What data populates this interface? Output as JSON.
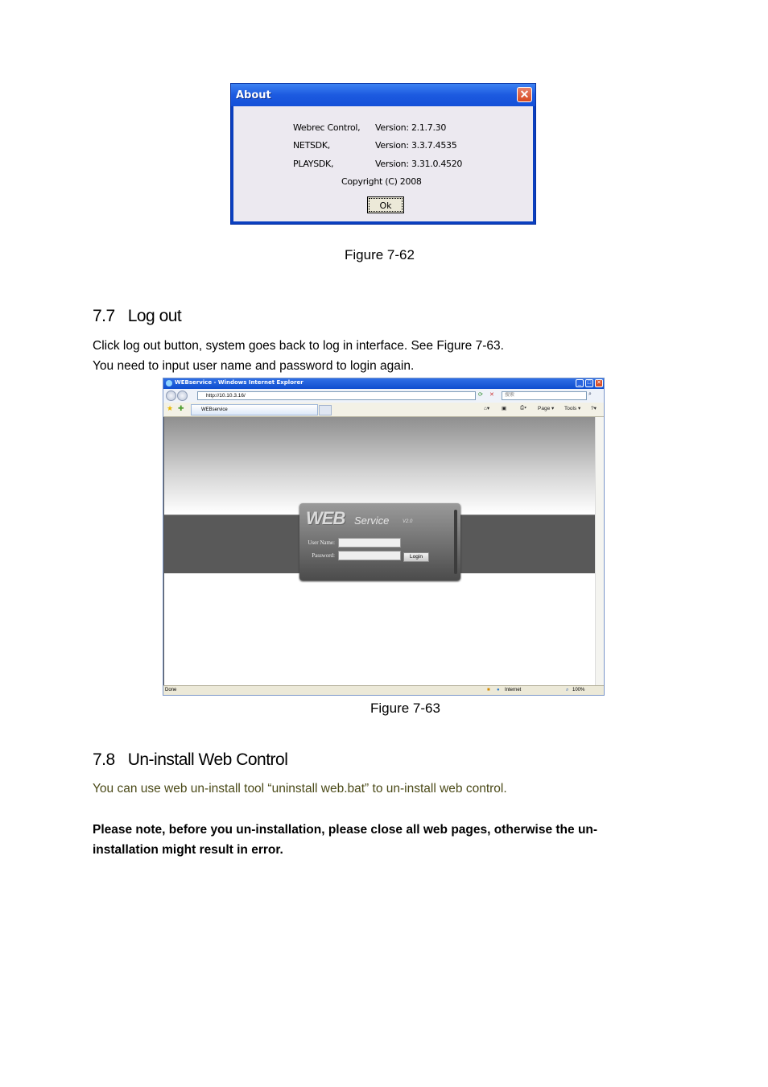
{
  "about_dialog": {
    "title": "About",
    "close_glyph": "✕",
    "rows": [
      {
        "name": "Webrec Control,",
        "version": "Version: 2.1.7.30"
      },
      {
        "name": "NETSDK,",
        "version": "Version: 3.3.7.4535"
      },
      {
        "name": "PLAYSDK,",
        "version": "Version: 3.31.0.4520"
      }
    ],
    "copyright": "Copyright (C) 2008",
    "ok_label": "Ok"
  },
  "figure_62_caption": "Figure 7-62",
  "section_77": {
    "heading": "7.7   Log out",
    "lines": [
      "Click log out button, system goes back to log in interface. See Figure 7-63.",
      "You need to input user name and password to login again."
    ]
  },
  "browser": {
    "window_title": "WEBservice - Windows Internet Explorer",
    "url": "http://10.10.3.16/",
    "search_placeholder": "搜索",
    "tab_label": "WEBservice",
    "command_items": {
      "page": "Page ▾",
      "tools": "Tools ▾"
    },
    "status_text": "Done",
    "zone_text": "Internet",
    "zoom_text": "100%",
    "login_panel": {
      "logo": "WEB",
      "service": "Service",
      "version": "V2.0",
      "username_label": "User Name:",
      "password_label": "Password:",
      "username_value": "",
      "password_value": "",
      "login_button": "Login"
    }
  },
  "figure_63_caption": "Figure 7-63",
  "section_78": {
    "heading": "7.8   Un-install Web Control",
    "text": "You can use web un-install tool “uninstall web.bat” to un-install web control.",
    "note_line1": "Please note, before you un-installation, please close all web pages, otherwise the un-",
    "note_line2": "installation might result in error."
  },
  "colors": {
    "olive_text": "#4b4a18",
    "xp_title_blue": "#1c5ae0"
  }
}
